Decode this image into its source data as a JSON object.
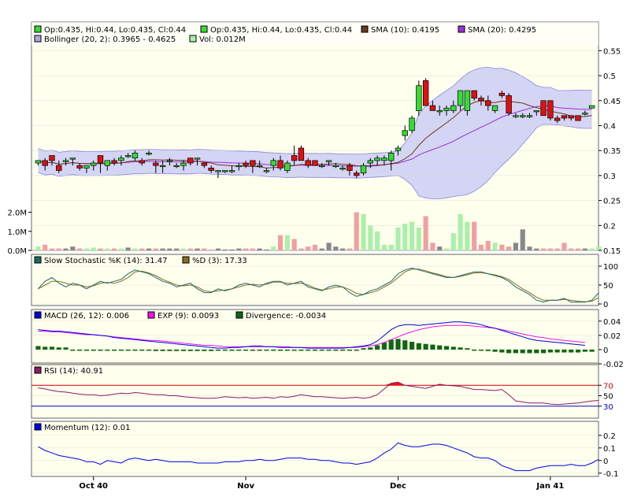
{
  "colors": {
    "up": "#33dd33",
    "down": "#dd1111",
    "up_wick": "#000000",
    "sma10": "#6b3a1a",
    "sma20": "#9b30d9",
    "boll_fill": "#d4d4f4",
    "boll_line": "#8888dd",
    "vol_up": "#aaf0aa",
    "vol_down": "#f0a0a0",
    "vol_flat": "#888888",
    "stoch_k": "#1a6b6b",
    "stoch_d": "#8b6b1a",
    "macd": "#0000dd",
    "exp": "#ee11ee",
    "divergence": "#116611",
    "rsi": "#8b1a6b",
    "rsi_fill": "#ee1111",
    "rsi_70": "#cc0000",
    "rsi_30": "#0000cc",
    "momentum": "#0000ee",
    "panel_bg": "#ffffee"
  },
  "legend": {
    "row1": [
      {
        "label": "Op:0.435, Hi:0.44, Lo:0.435, Cl:0.44",
        "color": "#33dd33"
      },
      {
        "label": "Op:0.435, Hi:0.44, Lo:0.435, Cl:0.44",
        "color": "#33dd33"
      },
      {
        "label": "SMA (10): 0.4195",
        "color": "#6b3a1a"
      },
      {
        "label": "SMA (20): 0.4295",
        "color": "#9b30d9"
      }
    ],
    "row2": [
      {
        "label": "Bollinger (20, 2): 0.3965 - 0.4625",
        "color": "#aaaadd"
      },
      {
        "label": "Vol: 0.012M",
        "color": "#aaf0aa"
      }
    ]
  },
  "panels": {
    "stoch": {
      "label_k": "Slow Stochastic %K (14): 31.47",
      "label_d": "%D (3): 17.33",
      "k_color": "#1a6b6b",
      "d_color": "#8b6b1a"
    },
    "macd": {
      "label_macd": "MACD (26, 12): 0.006",
      "label_exp": "EXP (9): 0.0093",
      "label_div": "Divergence: -0.0034"
    },
    "rsi": {
      "label": "RSI (14): 40.91"
    },
    "momentum": {
      "label": "Momentum (12): 0.01"
    }
  },
  "axes": {
    "price_ticks": [
      "0.55",
      "0.5",
      "0.45",
      "0.4",
      "0.35",
      "0.3",
      "0.25",
      "0.2",
      "0.15"
    ],
    "volume_ticks": [
      "2.0M",
      "1.0M",
      "0.0M"
    ],
    "stoch_ticks": [
      "100",
      "50",
      "0"
    ],
    "macd_ticks": [
      "0.04",
      "0.02",
      "0",
      "-0.02"
    ],
    "rsi_ticks": [
      "70",
      "50",
      "30"
    ],
    "momentum_ticks": [
      "0.2",
      "0.1",
      "0",
      "-0.1"
    ],
    "x_ticks": [
      {
        "label": "Oct 40",
        "index": 8
      },
      {
        "label": "Nov",
        "index": 30
      },
      {
        "label": "Dec",
        "index": 52
      },
      {
        "label": "Jan 41",
        "index": 74
      }
    ]
  },
  "chart_data": {
    "type": "candlestick",
    "price_range": [
      0.15,
      0.56
    ],
    "candles": [
      [
        0.325,
        0.33,
        0.32,
        0.33
      ],
      [
        0.33,
        0.335,
        0.31,
        0.32
      ],
      [
        0.34,
        0.34,
        0.32,
        0.33
      ],
      [
        0.32,
        0.33,
        0.305,
        0.31
      ],
      [
        0.33,
        0.335,
        0.32,
        0.33
      ],
      [
        0.335,
        0.335,
        0.32,
        0.335
      ],
      [
        0.32,
        0.325,
        0.31,
        0.315
      ],
      [
        0.315,
        0.32,
        0.305,
        0.32
      ],
      [
        0.32,
        0.33,
        0.31,
        0.325
      ],
      [
        0.34,
        0.34,
        0.305,
        0.325
      ],
      [
        0.32,
        0.33,
        0.31,
        0.33
      ],
      [
        0.33,
        0.335,
        0.32,
        0.325
      ],
      [
        0.33,
        0.34,
        0.32,
        0.335
      ],
      [
        0.34,
        0.345,
        0.335,
        0.34
      ],
      [
        0.335,
        0.35,
        0.33,
        0.345
      ],
      [
        0.33,
        0.335,
        0.32,
        0.325
      ],
      [
        0.345,
        0.35,
        0.34,
        0.345
      ],
      [
        0.325,
        0.33,
        0.305,
        0.32
      ],
      [
        0.32,
        0.33,
        0.305,
        0.32
      ],
      [
        0.33,
        0.335,
        0.32,
        0.33
      ],
      [
        0.32,
        0.325,
        0.315,
        0.32
      ],
      [
        0.32,
        0.33,
        0.31,
        0.325
      ],
      [
        0.335,
        0.335,
        0.32,
        0.325
      ],
      [
        0.335,
        0.335,
        0.32,
        0.335
      ],
      [
        0.325,
        0.325,
        0.315,
        0.32
      ],
      [
        0.315,
        0.32,
        0.305,
        0.31
      ],
      [
        0.31,
        0.31,
        0.295,
        0.31
      ],
      [
        0.31,
        0.31,
        0.305,
        0.31
      ],
      [
        0.31,
        0.32,
        0.305,
        0.31
      ],
      [
        0.32,
        0.325,
        0.31,
        0.32
      ],
      [
        0.325,
        0.33,
        0.315,
        0.32
      ],
      [
        0.33,
        0.33,
        0.305,
        0.32
      ],
      [
        0.32,
        0.33,
        0.315,
        0.32
      ],
      [
        0.31,
        0.315,
        0.305,
        0.31
      ],
      [
        0.32,
        0.335,
        0.31,
        0.33
      ],
      [
        0.33,
        0.34,
        0.31,
        0.315
      ],
      [
        0.31,
        0.33,
        0.305,
        0.325
      ],
      [
        0.34,
        0.36,
        0.32,
        0.33
      ],
      [
        0.355,
        0.36,
        0.33,
        0.33
      ],
      [
        0.33,
        0.335,
        0.315,
        0.32
      ],
      [
        0.33,
        0.33,
        0.32,
        0.32
      ],
      [
        0.32,
        0.325,
        0.315,
        0.32
      ],
      [
        0.33,
        0.33,
        0.32,
        0.33
      ],
      [
        0.32,
        0.325,
        0.315,
        0.32
      ],
      [
        0.315,
        0.32,
        0.31,
        0.315
      ],
      [
        0.32,
        0.325,
        0.3,
        0.31
      ],
      [
        0.305,
        0.31,
        0.295,
        0.3
      ],
      [
        0.305,
        0.325,
        0.3,
        0.32
      ],
      [
        0.325,
        0.335,
        0.315,
        0.33
      ],
      [
        0.33,
        0.34,
        0.32,
        0.335
      ],
      [
        0.33,
        0.34,
        0.32,
        0.335
      ],
      [
        0.33,
        0.35,
        0.31,
        0.345
      ],
      [
        0.35,
        0.36,
        0.34,
        0.355
      ],
      [
        0.38,
        0.4,
        0.37,
        0.39
      ],
      [
        0.39,
        0.42,
        0.385,
        0.415
      ],
      [
        0.43,
        0.49,
        0.42,
        0.48
      ],
      [
        0.49,
        0.495,
        0.44,
        0.44
      ],
      [
        0.44,
        0.45,
        0.43,
        0.43
      ],
      [
        0.43,
        0.44,
        0.42,
        0.43
      ],
      [
        0.43,
        0.44,
        0.42,
        0.435
      ],
      [
        0.43,
        0.45,
        0.425,
        0.44
      ],
      [
        0.44,
        0.47,
        0.43,
        0.47
      ],
      [
        0.43,
        0.47,
        0.42,
        0.47
      ],
      [
        0.47,
        0.47,
        0.45,
        0.455
      ],
      [
        0.455,
        0.46,
        0.44,
        0.45
      ],
      [
        0.45,
        0.46,
        0.43,
        0.44
      ],
      [
        0.43,
        0.44,
        0.425,
        0.44
      ],
      [
        0.465,
        0.47,
        0.455,
        0.46
      ],
      [
        0.46,
        0.465,
        0.42,
        0.425
      ],
      [
        0.42,
        0.425,
        0.415,
        0.42
      ],
      [
        0.42,
        0.425,
        0.415,
        0.42
      ],
      [
        0.42,
        0.425,
        0.415,
        0.42
      ],
      [
        0.43,
        0.43,
        0.42,
        0.43
      ],
      [
        0.45,
        0.45,
        0.42,
        0.42
      ],
      [
        0.45,
        0.45,
        0.41,
        0.415
      ],
      [
        0.415,
        0.42,
        0.405,
        0.41
      ],
      [
        0.42,
        0.42,
        0.41,
        0.415
      ],
      [
        0.42,
        0.42,
        0.41,
        0.415
      ],
      [
        0.42,
        0.42,
        0.41,
        0.41
      ],
      [
        0.425,
        0.43,
        0.42,
        0.425
      ],
      [
        0.435,
        0.44,
        0.435,
        0.44
      ]
    ],
    "volume_millions": [
      0.2,
      0.3,
      0.1,
      0.1,
      0.1,
      0.2,
      0.1,
      0.1,
      0.15,
      0.1,
      0.1,
      0.1,
      0.1,
      0.15,
      0.1,
      0.1,
      0.1,
      0.1,
      0.1,
      0.1,
      0.1,
      0.1,
      0.1,
      0.1,
      0.1,
      0.05,
      0.1,
      0.05,
      0.05,
      0.1,
      0.1,
      0.1,
      0.1,
      0.05,
      0.2,
      0.8,
      0.8,
      0.6,
      0.1,
      0.2,
      0.3,
      0.1,
      0.4,
      0.2,
      0.1,
      0.1,
      2.0,
      1.9,
      1.3,
      1.0,
      0.3,
      0.3,
      1.2,
      1.4,
      1.5,
      1.2,
      1.8,
      0.4,
      0.2,
      0.1,
      0.9,
      1.9,
      1.5,
      1.5,
      0.3,
      0.5,
      0.4,
      0.3,
      0.2,
      0.4,
      1.1,
      0.2,
      0.1,
      0.1,
      0.1,
      0.1,
      0.4,
      0.1,
      0.1,
      0.1,
      0.1,
      0.2
    ],
    "stoch_k": [
      40,
      60,
      70,
      55,
      45,
      55,
      50,
      40,
      50,
      60,
      55,
      60,
      65,
      80,
      90,
      85,
      80,
      70,
      60,
      55,
      45,
      50,
      55,
      40,
      30,
      30,
      40,
      35,
      40,
      50,
      55,
      50,
      45,
      55,
      60,
      60,
      50,
      55,
      60,
      45,
      40,
      35,
      45,
      50,
      45,
      30,
      20,
      25,
      35,
      40,
      50,
      60,
      80,
      90,
      95,
      90,
      85,
      80,
      75,
      70,
      70,
      75,
      80,
      85,
      85,
      80,
      75,
      70,
      60,
      45,
      35,
      25,
      10,
      5,
      10,
      10,
      15,
      5,
      5,
      5,
      10,
      30
    ],
    "stoch_d": [
      40,
      50,
      60,
      60,
      55,
      50,
      50,
      45,
      48,
      55,
      57,
      55,
      60,
      70,
      85,
      87,
      82,
      75,
      65,
      58,
      50,
      48,
      50,
      45,
      35,
      32,
      35,
      37,
      40,
      45,
      50,
      52,
      50,
      52,
      58,
      58,
      55,
      54,
      55,
      50,
      42,
      37,
      40,
      45,
      45,
      38,
      28,
      25,
      30,
      35,
      45,
      55,
      70,
      85,
      92,
      92,
      88,
      82,
      78,
      72,
      70,
      73,
      77,
      82,
      83,
      80,
      77,
      72,
      65,
      52,
      40,
      30,
      18,
      10,
      10,
      10,
      12,
      10,
      7,
      6,
      7,
      17
    ],
    "macd": [
      0.028,
      0.027,
      0.026,
      0.026,
      0.025,
      0.024,
      0.023,
      0.022,
      0.021,
      0.02,
      0.019,
      0.017,
      0.016,
      0.015,
      0.014,
      0.013,
      0.012,
      0.011,
      0.01,
      0.009,
      0.008,
      0.007,
      0.006,
      0.005,
      0.004,
      0.003,
      0.002,
      0.002,
      0.003,
      0.003,
      0.004,
      0.005,
      0.005,
      0.004,
      0.004,
      0.003,
      0.003,
      0.003,
      0.003,
      0.002,
      0.002,
      0.002,
      0.002,
      0.002,
      0.002,
      0.003,
      0.004,
      0.005,
      0.007,
      0.012,
      0.02,
      0.028,
      0.033,
      0.035,
      0.035,
      0.034,
      0.035,
      0.036,
      0.037,
      0.038,
      0.039,
      0.039,
      0.038,
      0.037,
      0.035,
      0.032,
      0.03,
      0.027,
      0.024,
      0.021,
      0.018,
      0.015,
      0.013,
      0.012,
      0.011,
      0.01,
      0.009,
      0.008,
      0.007,
      0.006
    ],
    "exp": [
      0.026,
      0.026,
      0.025,
      0.025,
      0.024,
      0.023,
      0.022,
      0.021,
      0.021,
      0.02,
      0.019,
      0.018,
      0.017,
      0.016,
      0.015,
      0.014,
      0.013,
      0.013,
      0.012,
      0.011,
      0.01,
      0.009,
      0.008,
      0.007,
      0.006,
      0.006,
      0.005,
      0.004,
      0.004,
      0.004,
      0.004,
      0.004,
      0.004,
      0.004,
      0.004,
      0.004,
      0.004,
      0.003,
      0.003,
      0.003,
      0.003,
      0.003,
      0.003,
      0.003,
      0.003,
      0.003,
      0.003,
      0.004,
      0.005,
      0.007,
      0.01,
      0.014,
      0.018,
      0.022,
      0.025,
      0.028,
      0.03,
      0.032,
      0.033,
      0.034,
      0.034,
      0.034,
      0.034,
      0.033,
      0.032,
      0.031,
      0.03,
      0.028,
      0.026,
      0.024,
      0.022,
      0.02,
      0.018,
      0.017,
      0.015,
      0.014,
      0.013,
      0.012,
      0.011,
      0.01
    ],
    "divergence": [
      0.005,
      0.004,
      0.004,
      0.003,
      0.003,
      0,
      -0.001,
      -0.001,
      -0.001,
      -0.001,
      -0.001,
      -0.001,
      -0.001,
      -0.001,
      -0.001,
      -0.001,
      -0.001,
      -0.002,
      -0.002,
      -0.002,
      -0.002,
      -0.002,
      -0.002,
      -0.002,
      -0.002,
      -0.002,
      -0.001,
      -0.001,
      -0.001,
      -0.001,
      -0.001,
      -0.001,
      -0.001,
      -0.001,
      -0.001,
      -0.001,
      -0.001,
      -0.001,
      0,
      0,
      -0.001,
      -0.001,
      -0.001,
      -0.001,
      -0.001,
      -0.001,
      -0.001,
      0.002,
      0.003,
      0.006,
      0.01,
      0.014,
      0.015,
      0.013,
      0.011,
      0.009,
      0.008,
      0.007,
      0.006,
      0.005,
      0.004,
      0.003,
      0.002,
      0,
      -0.001,
      -0.002,
      -0.003,
      -0.004,
      -0.005,
      -0.005,
      -0.005,
      -0.005,
      -0.005,
      -0.005,
      -0.004,
      -0.004,
      -0.004,
      -0.004,
      -0.004,
      -0.003,
      -0.003
    ],
    "rsi": [
      65,
      63,
      60,
      58,
      57,
      55,
      53,
      52,
      52,
      50,
      51,
      53,
      55,
      54,
      56,
      55,
      53,
      52,
      52,
      50,
      50,
      48,
      47,
      46,
      45,
      45,
      46,
      48,
      47,
      46,
      47,
      45,
      46,
      47,
      45,
      48,
      47,
      49,
      52,
      50,
      48,
      48,
      47,
      46,
      45,
      46,
      47,
      45,
      47,
      52,
      63,
      74,
      76,
      70,
      68,
      66,
      64,
      68,
      72,
      70,
      69,
      68,
      65,
      62,
      62,
      61,
      60,
      62,
      52,
      40,
      38,
      36,
      36,
      36,
      34,
      33,
      34,
      35,
      36,
      38,
      40,
      41
    ],
    "rsi_range": [
      10,
      90
    ],
    "momentum": [
      0.11,
      0.08,
      0.06,
      0.04,
      0.03,
      0.02,
      0.01,
      -0.01,
      -0.01,
      -0.03,
      0,
      -0.01,
      -0.02,
      0.01,
      0.02,
      0.01,
      0,
      0.01,
      0,
      -0.01,
      -0.01,
      -0.01,
      -0.01,
      -0.02,
      -0.02,
      -0.02,
      -0.02,
      -0.01,
      -0.01,
      -0.01,
      0,
      0,
      0.01,
      0,
      0,
      0.01,
      0.02,
      0.02,
      0.02,
      0.01,
      0.01,
      0,
      0,
      -0.01,
      -0.02,
      -0.02,
      -0.03,
      -0.02,
      -0.01,
      0.02,
      0.06,
      0.09,
      0.14,
      0.12,
      0.11,
      0.11,
      0.12,
      0.13,
      0.13,
      0.12,
      0.1,
      0.08,
      0.06,
      0.03,
      0.02,
      0.02,
      0.0,
      -0.04,
      -0.06,
      -0.08,
      -0.08,
      -0.08,
      -0.06,
      -0.05,
      -0.04,
      -0.04,
      -0.04,
      -0.03,
      -0.04,
      -0.04,
      -0.02,
      0.01
    ],
    "momentum_range": [
      -0.12,
      0.23
    ]
  }
}
